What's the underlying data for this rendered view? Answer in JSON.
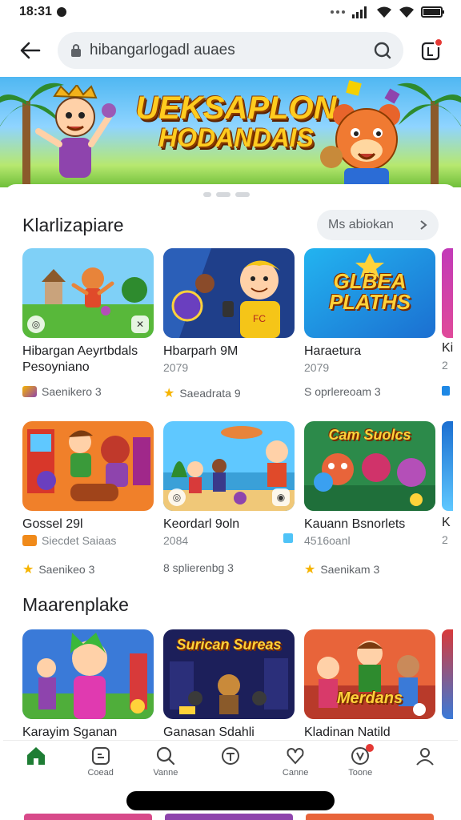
{
  "status": {
    "time": "18:31"
  },
  "search": {
    "query": "hibangarlogadl auaes"
  },
  "banner": {
    "line1": "UEKSAPLON",
    "line2": "HODANDAIS"
  },
  "section1": {
    "title": "Klarlizapiare",
    "more_label": "Ms abiokan",
    "cards": [
      {
        "name": "Hibargan Aeyrtbdals",
        "sub": "Pesoyniano",
        "meta": "Saenikero 3",
        "thumb_text": ""
      },
      {
        "name": "Hbarparh 9M",
        "sub": "2079",
        "meta": "Saeadrata 9",
        "thumb_text": ""
      },
      {
        "name": "Haraetura",
        "sub": "2079",
        "meta": "S oprlereoam 3",
        "thumb_text": "GLBEA PLATHS"
      },
      {
        "name": "Gossel 29l",
        "sub": "Siecdet Saiaas",
        "meta": "Saenikeo 3",
        "thumb_text": ""
      },
      {
        "name": "Keordarl 9oln",
        "sub": "2084",
        "meta": "8 splierenbg 3",
        "thumb_text": ""
      },
      {
        "name": "Kauann Bsnorlets",
        "sub": "4516oanl",
        "meta": "Saenikam 3",
        "thumb_text": "Cam Suolcs"
      }
    ],
    "edge_labels": [
      "Ki",
      "2",
      "K",
      "2"
    ]
  },
  "section2": {
    "title": "Maarenplake",
    "cards": [
      {
        "name": "Karayim Sganan",
        "thumb_text": ""
      },
      {
        "name": "Ganasan Sdahli",
        "thumb_text": "Surican Sureas"
      },
      {
        "name": "Kladinan Natild",
        "thumb_text": "Merdans"
      }
    ]
  },
  "nav": [
    {
      "label": "",
      "icon": "home-icon"
    },
    {
      "label": "Coead",
      "icon": "games-icon"
    },
    {
      "label": "Vanne",
      "icon": "search-icon"
    },
    {
      "label": "",
      "icon": "apps-icon"
    },
    {
      "label": "Canne",
      "icon": "heart-icon"
    },
    {
      "label": "Toone",
      "icon": "books-icon"
    },
    {
      "label": "",
      "icon": "profile-icon"
    }
  ],
  "colors": {
    "accent": "#1e7d34",
    "badge": "#e53935",
    "star": "#f6b400"
  }
}
